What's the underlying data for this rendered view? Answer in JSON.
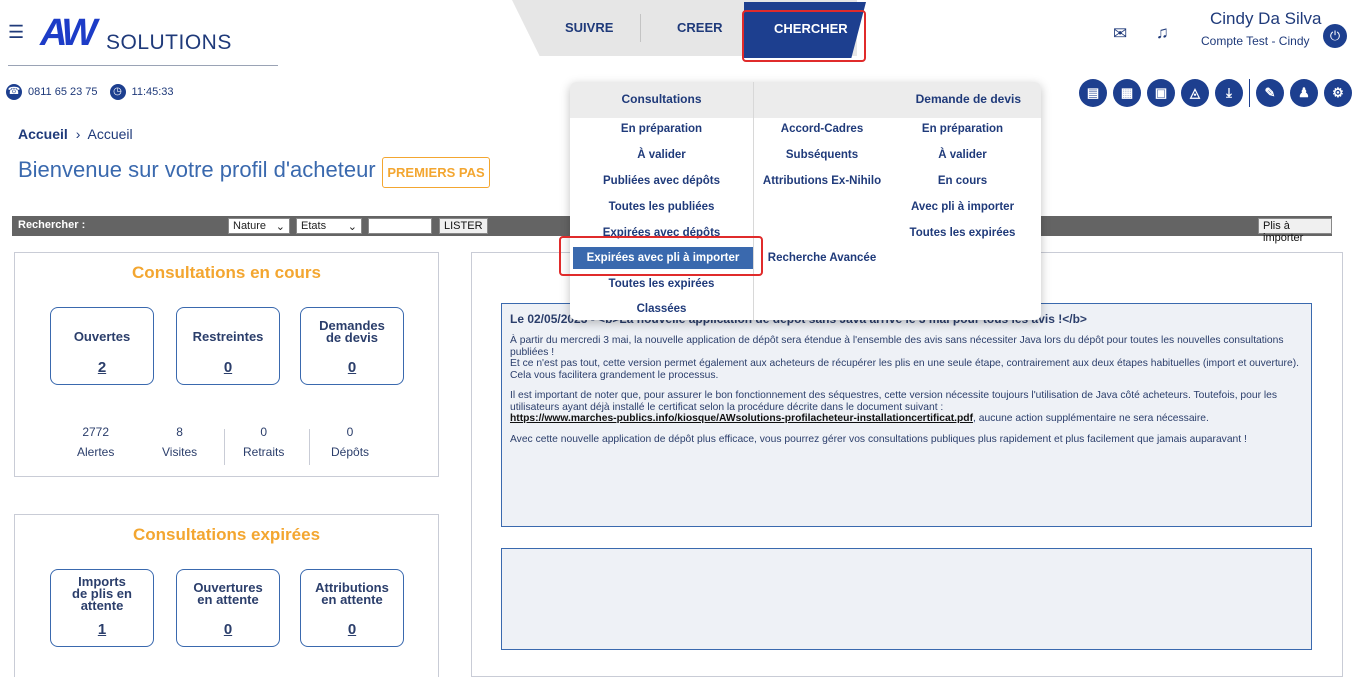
{
  "header": {
    "logo": {
      "mark": "AW",
      "text": "SOLUTIONS"
    },
    "nav": {
      "suivre": "SUIVRE",
      "creer": "CREER",
      "chercher": "CHERCHER"
    },
    "user": {
      "name": "Cindy Da Silva",
      "account": "Compte Test - Cindy"
    },
    "phone": "0811 65 23 75",
    "time": "11:45:33",
    "icons": [
      "mail-icon",
      "bell-icon",
      "power-icon",
      "document-icon",
      "calculator-icon",
      "pdf-icon",
      "agent-icon",
      "download-icon",
      "edit-icon",
      "users-icon",
      "user-settings-icon"
    ]
  },
  "breadcrumb": {
    "root": "Accueil",
    "separator": "›",
    "current": "Accueil"
  },
  "page": {
    "title": "Bienvenue sur votre profil d'acheteur",
    "premiers_pas": "PREMIERS PAS"
  },
  "searchbar": {
    "label": "Rechercher :",
    "nature": "Nature",
    "etats": "Etats",
    "lister": "LISTER",
    "plis": "Plis à importer"
  },
  "consultations_en_cours": {
    "title": "Consultations en cours",
    "tiles": [
      {
        "label": "Ouvertes",
        "value": "2"
      },
      {
        "label": "Restreintes",
        "value": "0"
      },
      {
        "label": "Demandes de devis",
        "value": "0"
      }
    ],
    "stats": [
      {
        "value": "2772",
        "label": "Alertes"
      },
      {
        "value": "8",
        "label": "Visites"
      },
      {
        "value": "0",
        "label": "Retraits"
      },
      {
        "value": "0",
        "label": "Dépôts"
      }
    ]
  },
  "consultations_expirees": {
    "title": "Consultations expirées",
    "tiles": [
      {
        "label": "Imports de plis en attente",
        "value": "1"
      },
      {
        "label": "Ouvertures en attente",
        "value": "0"
      },
      {
        "label": "Attributions en attente",
        "value": "0"
      }
    ]
  },
  "news": {
    "title": "Le 02/05/2023 - <b>La nouvelle application de dépôt sans Java arrive le 3 mai pour tous les avis !</b>",
    "p1": "À partir du mercredi 3 mai, la nouvelle application de dépôt sera étendue à l'ensemble des avis sans nécessiter Java lors du dépôt pour toutes les nouvelles consultations publiées !",
    "p1b": "Et ce n'est pas tout, cette version permet également aux acheteurs de récupérer les plis en une seule étape, contrairement aux deux étapes habituelles (import et ouverture). Cela vous facilitera grandement le processus.",
    "p2": "Il est important de noter que, pour assurer le bon fonctionnement des séquestres, cette version nécessite toujours l'utilisation de Java côté acheteurs. Toutefois, pour les utilisateurs ayant déjà installé le certificat selon la procédure décrite dans le document suivant :",
    "link": "https://www.marches-publics.info/kiosque/AWsolutions-profilacheteur-installationcertificat.pdf",
    "p2b": ", aucune action supplémentaire ne sera nécessaire.",
    "p3": "Avec cette nouvelle application de dépôt plus efficace, vous pourrez gérer vos consultations publiques plus rapidement et plus facilement que jamais auparavant !"
  },
  "dropdown": {
    "head_left": "Consultations",
    "head_right": "Demande de devis",
    "col1": [
      "En préparation",
      "À valider",
      "Publiées avec dépôts",
      "Toutes les publiées",
      "Expirées avec dépôts",
      "Expirées avec pli à  importer",
      "Toutes les expirées",
      "Classées"
    ],
    "col2": [
      "Accord-Cadres",
      "Subséquents",
      "Attributions Ex-Nihilo",
      "Recherche Avancée"
    ],
    "col3": [
      "En préparation",
      "À valider",
      "En cours",
      "Avec pli à  importer",
      "Toutes les expirées"
    ]
  },
  "colors": {
    "primary": "#1d3f8f",
    "accent": "#f3a630",
    "highlight": "#e02b2b"
  }
}
